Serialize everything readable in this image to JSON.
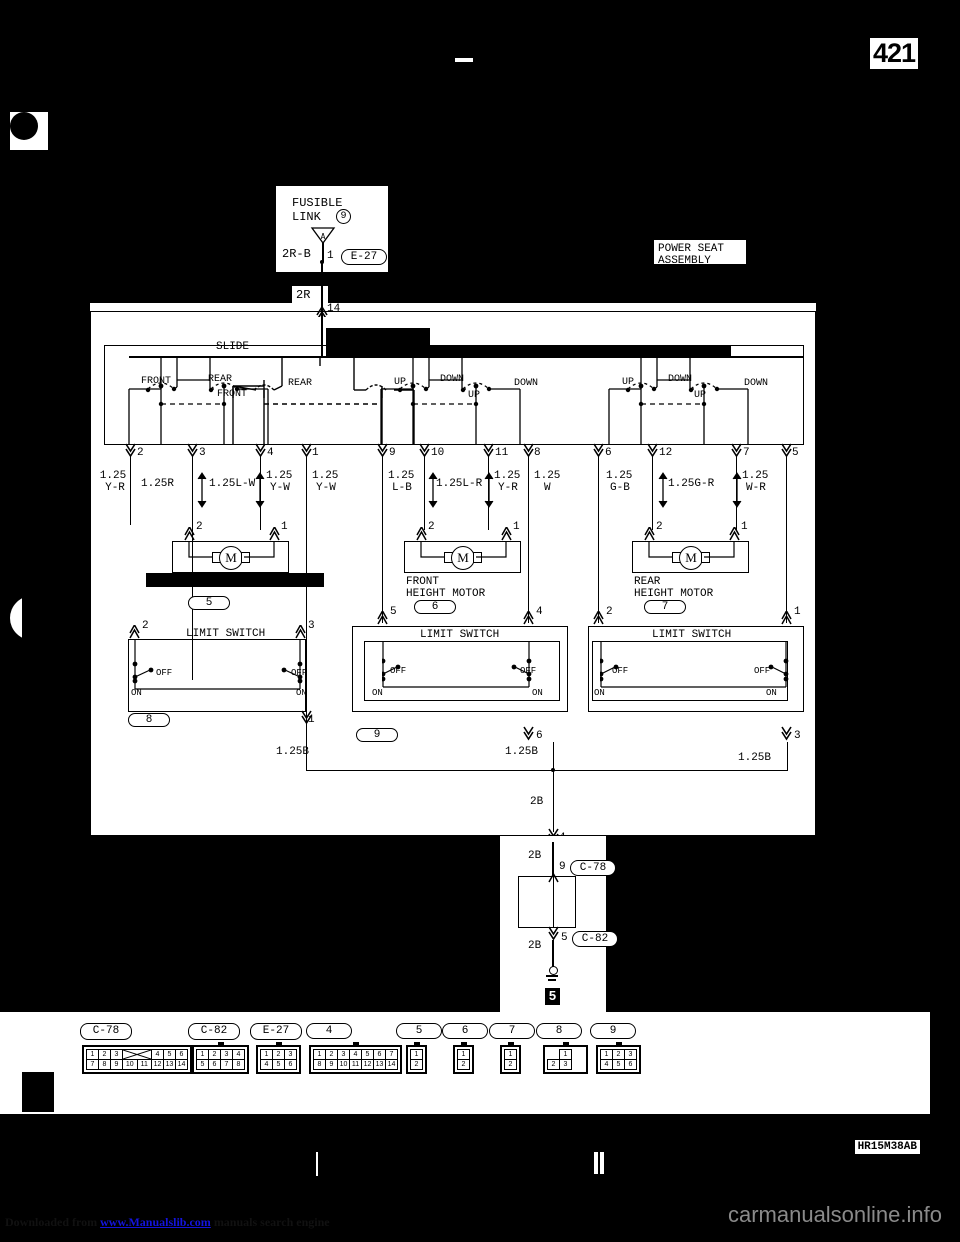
{
  "page": {
    "number": "421",
    "diagram_code": "HR15M38AB"
  },
  "watermarks": {
    "left_prefix": "Downloaded from ",
    "left_link": "www.Manualslib.com",
    "left_suffix": " manuals search engine",
    "right": "carmanualsonline.info"
  },
  "fusible_link": {
    "title_line1": "FUSIBLE",
    "title_line2": "LINK",
    "number": "9",
    "wire": "2R-B",
    "pin": "1",
    "connector": "E-27",
    "branch_wire": "2R",
    "branch_pin": "14"
  },
  "assembly": {
    "label_line1": "POWER SEAT",
    "label_line2": "ASSEMBLY"
  },
  "switch_groups": [
    {
      "name": "slide-switch",
      "title": "SLIDE",
      "positions": [
        "FRONT",
        "REAR",
        "FRONT",
        "REAR"
      ]
    },
    {
      "name": "front-height-switch",
      "title": "",
      "positions": [
        "UP",
        "DOWN",
        "UP",
        "DOWN"
      ]
    },
    {
      "name": "rear-height-switch",
      "title": "",
      "positions": [
        "UP",
        "DOWN",
        "UP",
        "DOWN"
      ]
    }
  ],
  "switch_pins": [
    "2",
    "3",
    "4",
    "1",
    "9",
    "10",
    "11",
    "8",
    "6",
    "12",
    "7",
    "5"
  ],
  "wire_labels": [
    {
      "text": "1.25\nY-R",
      "arrow": false
    },
    {
      "text": "1.25R",
      "arrow": false
    },
    {
      "text": "1.25L-W",
      "arrow": true
    },
    {
      "text": "1.25\nY-W",
      "arrow": true
    },
    {
      "text": "1.25\nY-W",
      "arrow": false
    },
    {
      "text": "1.25\nL-B",
      "arrow": false
    },
    {
      "text": "1.25L-R",
      "arrow": true
    },
    {
      "text": "1.25\nY-R",
      "arrow": true
    },
    {
      "text": "1.25\nW",
      "arrow": false
    },
    {
      "text": "1.25\nG-B",
      "arrow": false
    },
    {
      "text": "1.25G-R",
      "arrow": true
    },
    {
      "text": "1.25\nW-R",
      "arrow": true
    }
  ],
  "motors": [
    {
      "name": "slide-motor",
      "label_line1": "",
      "label_line2": "",
      "redacted": true,
      "tag": "5",
      "pins": [
        "2",
        "1"
      ]
    },
    {
      "name": "front-height-motor",
      "label_line1": "FRONT",
      "label_line2": "HEIGHT MOTOR",
      "redacted": false,
      "tag": "6",
      "pins": [
        "2",
        "1"
      ]
    },
    {
      "name": "rear-height-motor",
      "label_line1": "REAR",
      "label_line2": "HEIGHT MOTOR",
      "redacted": false,
      "tag": "7",
      "pins": [
        "2",
        "1"
      ]
    }
  ],
  "limit_switches": [
    {
      "name": "slide-limit-switch",
      "title": "LIMIT SWITCH",
      "tag": "8",
      "states": [
        "OFF",
        "ON",
        "OFF",
        "ON"
      ],
      "pin_in": "2",
      "pin_right": "3",
      "pin_out": "1"
    },
    {
      "name": "front-height-limit-switch",
      "title": "LIMIT SWITCH",
      "tag": "9",
      "states": [
        "OFF",
        "ON",
        "OFF",
        "ON"
      ],
      "pin_in": "5",
      "pin_right": "4",
      "pin_out": "6"
    },
    {
      "name": "rear-height-limit-switch",
      "title": "LIMIT SWITCH",
      "tag": "",
      "states": [
        "OFF",
        "ON",
        "OFF",
        "ON"
      ],
      "pin_in": "2",
      "pin_right": "1",
      "pin_out": "3"
    }
  ],
  "ground_wires": {
    "w1": "1.25B",
    "w2": "1.25B",
    "w3": "1.25B",
    "trunk": "2B",
    "seg_a": "2B",
    "seg_b": "2B",
    "pin_top": "4",
    "pin_c78": "9",
    "tag_c78": "C-78",
    "pin_c82": "5",
    "tag_c82": "C-82",
    "ground_point": "5"
  },
  "motor_branch_pins": {
    "slide_left": "2",
    "slide_right": "3",
    "fh_left": "5",
    "fh_right": "4",
    "rh_left": "2",
    "rh_right": "1"
  },
  "connector_table": [
    {
      "id": "C-78",
      "rows": [
        [
          "1",
          "2",
          "3",
          "X",
          "X",
          "4",
          "5",
          "6"
        ],
        [
          "7",
          "8",
          "9",
          "10",
          "11",
          "12",
          "13",
          "14"
        ]
      ],
      "cross": true
    },
    {
      "id": "C-82",
      "rows": [
        [
          "1",
          "2",
          "3",
          "4"
        ],
        [
          "5",
          "6",
          "7",
          "8"
        ]
      ],
      "cross": false
    },
    {
      "id": "E-27",
      "rows": [
        [
          "1",
          "2",
          "3"
        ],
        [
          "4",
          "5",
          "6"
        ]
      ],
      "cross": false
    },
    {
      "id": "4",
      "rows": [
        [
          "1",
          "2",
          "3",
          "4",
          "5",
          "6",
          "7"
        ],
        [
          "8",
          "9",
          "10",
          "11",
          "12",
          "13",
          "14"
        ]
      ],
      "cross": false
    },
    {
      "id": "5",
      "rows": [
        [
          "1"
        ],
        [
          "2"
        ]
      ],
      "cross": false
    },
    {
      "id": "6",
      "rows": [
        [
          "1"
        ],
        [
          "2"
        ]
      ],
      "cross": false
    },
    {
      "id": "7",
      "rows": [
        [
          "1"
        ],
        [
          "2"
        ]
      ],
      "cross": false
    },
    {
      "id": "8",
      "rows": [
        [
          "",
          "1",
          ""
        ],
        [
          "2",
          "3",
          ""
        ]
      ],
      "cross": false
    },
    {
      "id": "9",
      "rows": [
        [
          "1",
          "2",
          "3"
        ],
        [
          "4",
          "5",
          "6"
        ]
      ],
      "cross": false
    }
  ]
}
